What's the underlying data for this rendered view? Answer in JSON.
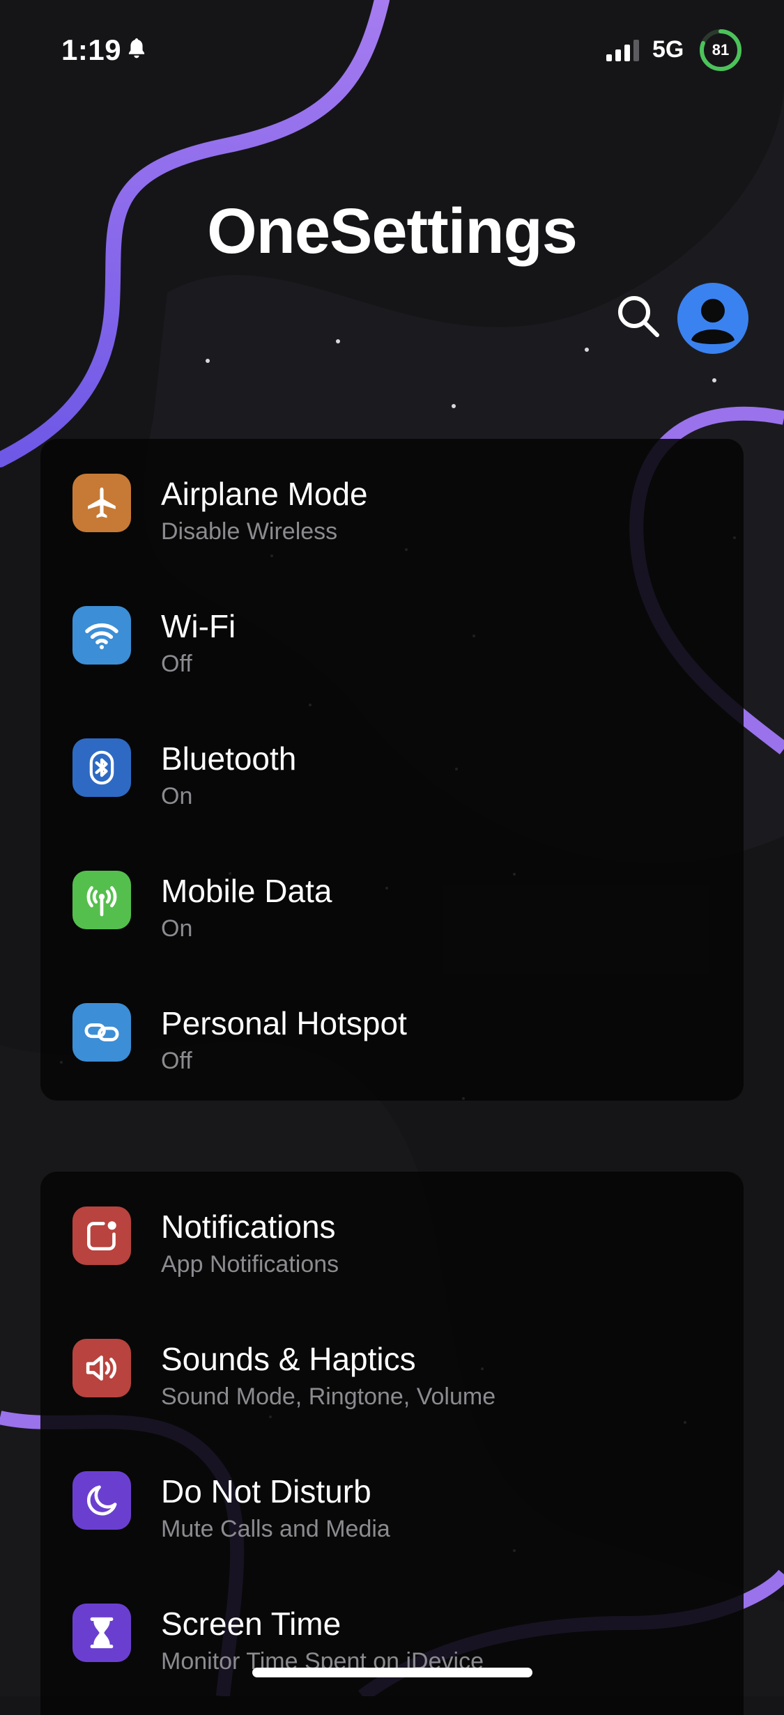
{
  "status_bar": {
    "time": "1:19",
    "network": "5G",
    "battery": "81",
    "battery_color": "#4cc35a"
  },
  "header": {
    "title": "OneSettings",
    "search_icon": "search-icon",
    "avatar_icon": "person-icon",
    "accent": "#3a82f0"
  },
  "groups": [
    {
      "items": [
        {
          "title": "Airplane Mode",
          "subtitle": "Disable Wireless",
          "icon": "airplane-icon",
          "color": "#c77a35"
        },
        {
          "title": "Wi-Fi",
          "subtitle": "Off",
          "icon": "wifi-icon",
          "color": "#3c8ed6"
        },
        {
          "title": "Bluetooth",
          "subtitle": "On",
          "icon": "bluetooth-icon",
          "color": "#2e6ac4"
        },
        {
          "title": "Mobile Data",
          "subtitle": "On",
          "icon": "antenna-icon",
          "color": "#55bf4d"
        },
        {
          "title": "Personal Hotspot",
          "subtitle": "Off",
          "icon": "link-icon",
          "color": "#3c8ed6"
        }
      ]
    },
    {
      "items": [
        {
          "title": "Notifications",
          "subtitle": "App Notifications",
          "icon": "notification-badge-icon",
          "color": "#b9433e"
        },
        {
          "title": "Sounds & Haptics",
          "subtitle": "Sound Mode, Ringtone, Volume",
          "icon": "speaker-icon",
          "color": "#b9433e"
        },
        {
          "title": "Do Not Disturb",
          "subtitle": "Mute Calls and Media",
          "icon": "moon-icon",
          "color": "#6a3fd0"
        },
        {
          "title": "Screen Time",
          "subtitle": "Monitor Time Spent on iDevice",
          "icon": "hourglass-icon",
          "color": "#6a3fd0"
        }
      ]
    }
  ]
}
